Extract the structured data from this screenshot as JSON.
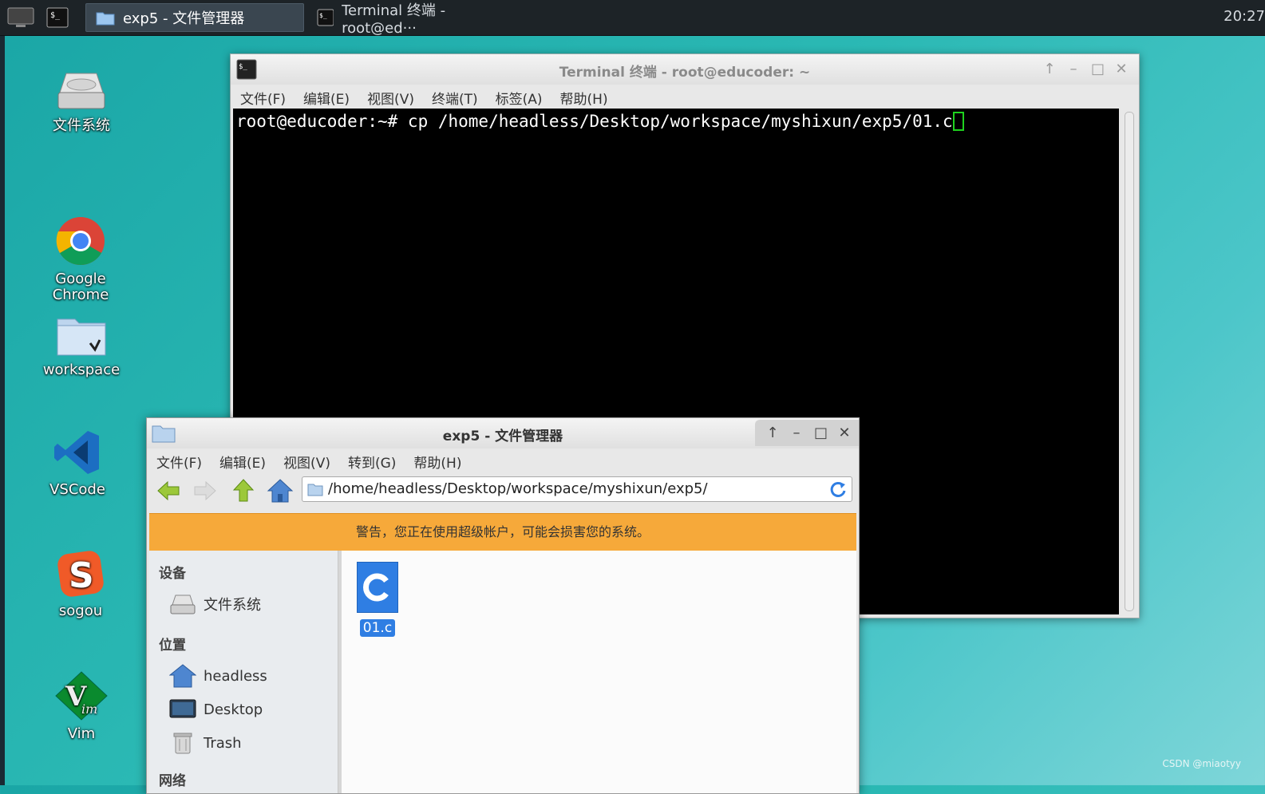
{
  "panel": {
    "tasks": [
      {
        "label": "exp5 - 文件管理器",
        "active": true
      },
      {
        "label": "Terminal 终端 - root@ed···",
        "active": false
      }
    ],
    "clock": "20:27"
  },
  "desktop": {
    "icons": [
      {
        "label": "文件系统"
      },
      {
        "label": "Google\nChrome"
      },
      {
        "label": "workspace"
      },
      {
        "label": "VSCode"
      },
      {
        "label": "sogou"
      },
      {
        "label": "Vim"
      }
    ]
  },
  "terminal": {
    "title": "Terminal 终端 - root@educoder: ~",
    "menu": [
      "文件(F)",
      "编辑(E)",
      "视图(V)",
      "终端(T)",
      "标签(A)",
      "帮助(H)"
    ],
    "command_line": "root@educoder:~# cp /home/headless/Desktop/workspace/myshixun/exp5/01.c"
  },
  "file_manager": {
    "title": "exp5 - 文件管理器",
    "menu": [
      "文件(F)",
      "编辑(E)",
      "视图(V)",
      "转到(G)",
      "帮助(H)"
    ],
    "address": "/home/headless/Desktop/workspace/myshixun/exp5/",
    "warning": "警告，您正在使用超级帐户，可能会损害您的系统。",
    "sidebar": {
      "devices_header": "设备",
      "devices": [
        {
          "label": "文件系统"
        }
      ],
      "places_header": "位置",
      "places": [
        {
          "label": "headless"
        },
        {
          "label": "Desktop"
        },
        {
          "label": "Trash"
        }
      ],
      "network_header": "网络"
    },
    "files": [
      {
        "name": "01.c"
      }
    ]
  },
  "watermark": "CSDN @miaotyy"
}
